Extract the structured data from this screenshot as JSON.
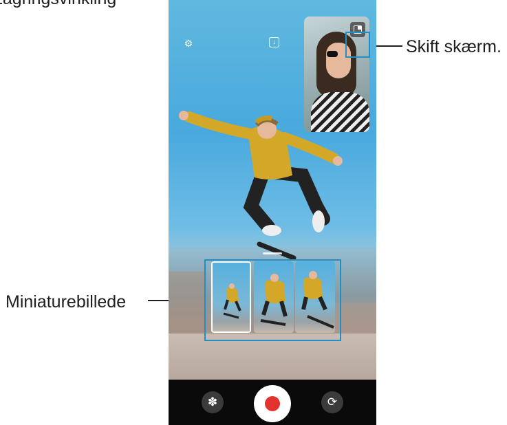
{
  "callouts": {
    "top_left_label": "Lagringsvinkling",
    "switch_screen_label": "Skift skærm.",
    "thumbnail_label": "Miniaturebillede"
  },
  "toolbar": {
    "settings_icon": "gear-icon",
    "download_icon": "download-icon"
  },
  "pip": {
    "switch_icon": "switch-screen-icon"
  },
  "thumbnails": {
    "count": 3,
    "selected_index": 0
  },
  "bottom_bar": {
    "effects_icon": "flower-icon",
    "record_icon": "record-icon",
    "switch_camera_icon": "rotate-camera-icon"
  },
  "colors": {
    "callout_accent": "#1f8fc6",
    "record_red": "#e2332f"
  }
}
